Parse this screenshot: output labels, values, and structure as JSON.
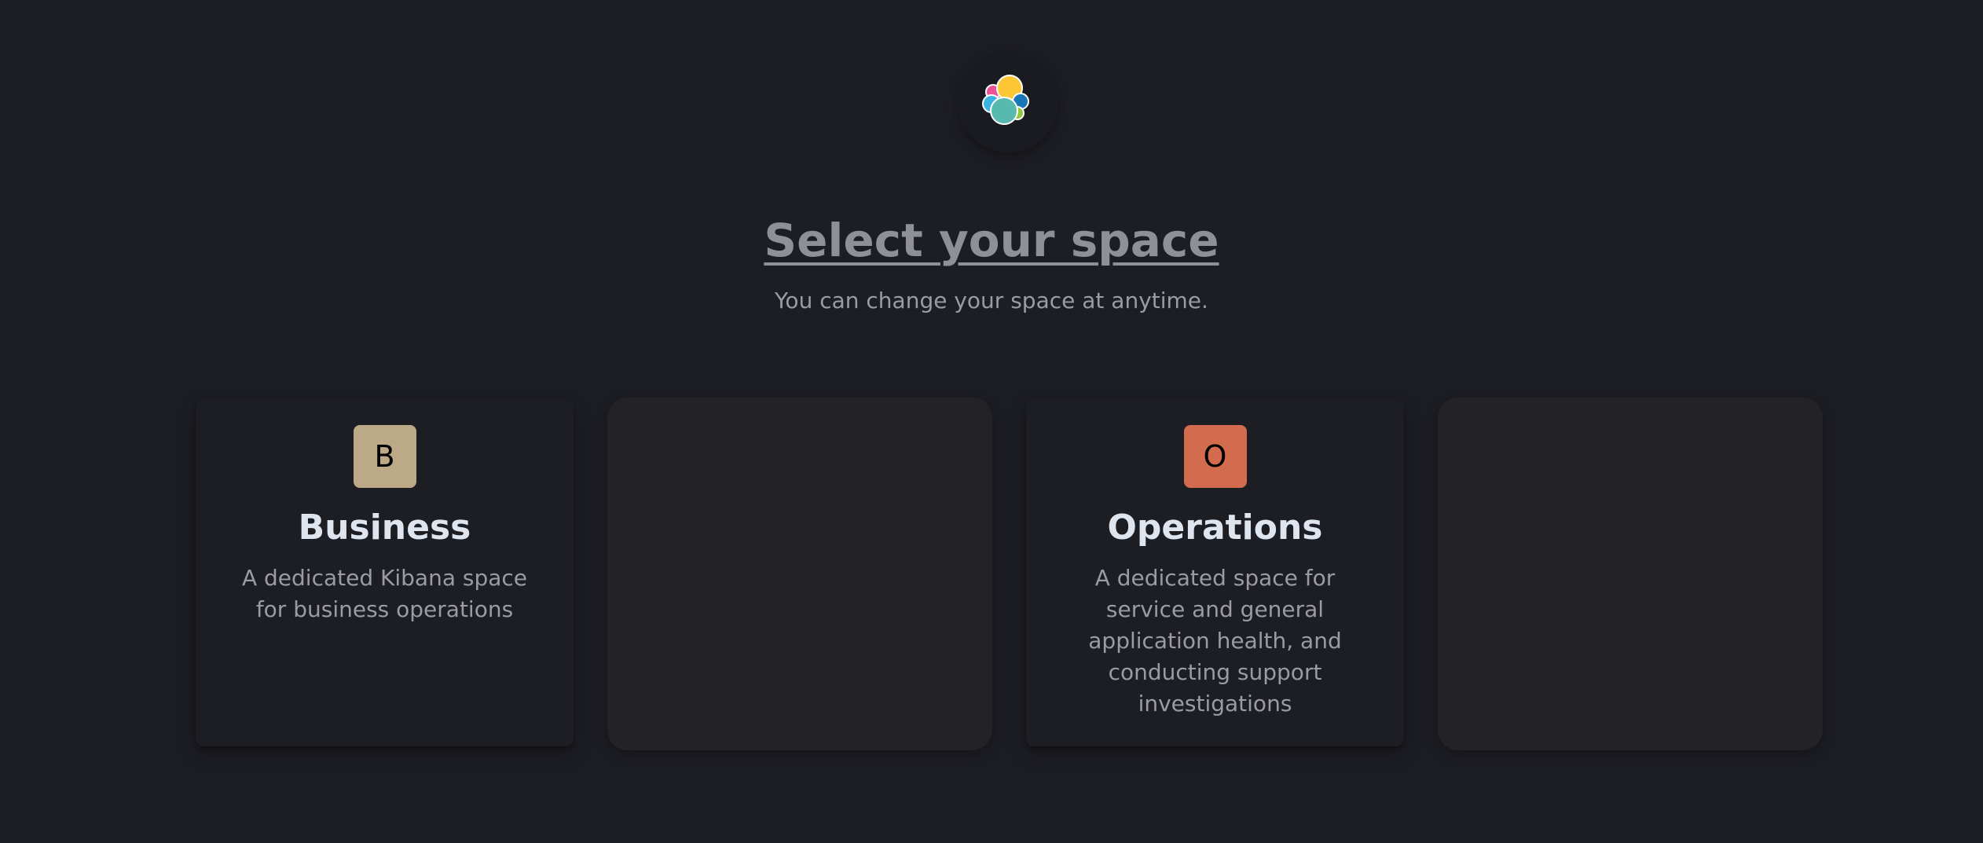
{
  "header": {
    "logo_icon": "elastic-logo-icon",
    "title": "Select your space",
    "subtitle": "You can change your space at anytime."
  },
  "spaces": [
    {
      "avatar_letter": "B",
      "avatar_color": "#bca987",
      "name": "Business",
      "description": "A dedicated Kibana space for business operations"
    },
    {
      "avatar_letter": "O",
      "avatar_color": "#d36b4f",
      "name": "Operations",
      "description": "A dedicated space for service and general application health, and conducting support investigations"
    }
  ],
  "colors": {
    "background": "#1d1e24",
    "card": "#1d1e23",
    "placeholder_card": "#232325"
  }
}
